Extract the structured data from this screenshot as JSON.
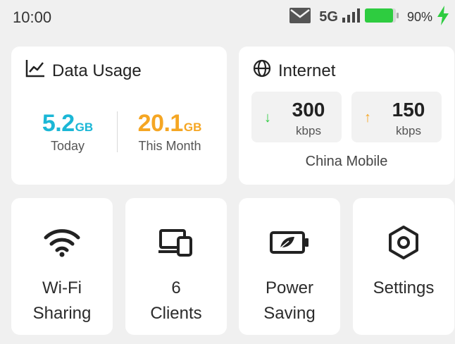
{
  "status_bar": {
    "time": "10:00",
    "network": "5G",
    "battery_percent": "90%",
    "battery_level": 0.9,
    "icons": [
      "mail-icon",
      "signal-icon",
      "battery-icon",
      "charging-icon"
    ],
    "colors": {
      "battery": "#2ecc40",
      "charging": "#2ecc40"
    }
  },
  "data_usage": {
    "title": "Data Usage",
    "today": {
      "value": "5.2",
      "unit": "GB",
      "label": "Today",
      "color": "#1bb7d6"
    },
    "month": {
      "value": "20.1",
      "unit": "GB",
      "label": "This Month",
      "color": "#f5a623"
    }
  },
  "internet": {
    "title": "Internet",
    "download": {
      "value": "300",
      "unit": "kbps",
      "arrow_color": "#2ecc40"
    },
    "upload": {
      "value": "150",
      "unit": "kbps",
      "arrow_color": "#f5a623"
    },
    "carrier": "China Mobile"
  },
  "tiles": {
    "wifi": {
      "line1": "Wi-Fi",
      "line2": "Sharing",
      "icon": "wifi-icon"
    },
    "clients": {
      "line1": "6",
      "line2": "Clients",
      "icon": "devices-icon"
    },
    "power": {
      "line1": "Power",
      "line2": "Saving",
      "icon": "power-saving-icon"
    },
    "settings": {
      "line1": "Settings",
      "icon": "settings-icon"
    }
  }
}
